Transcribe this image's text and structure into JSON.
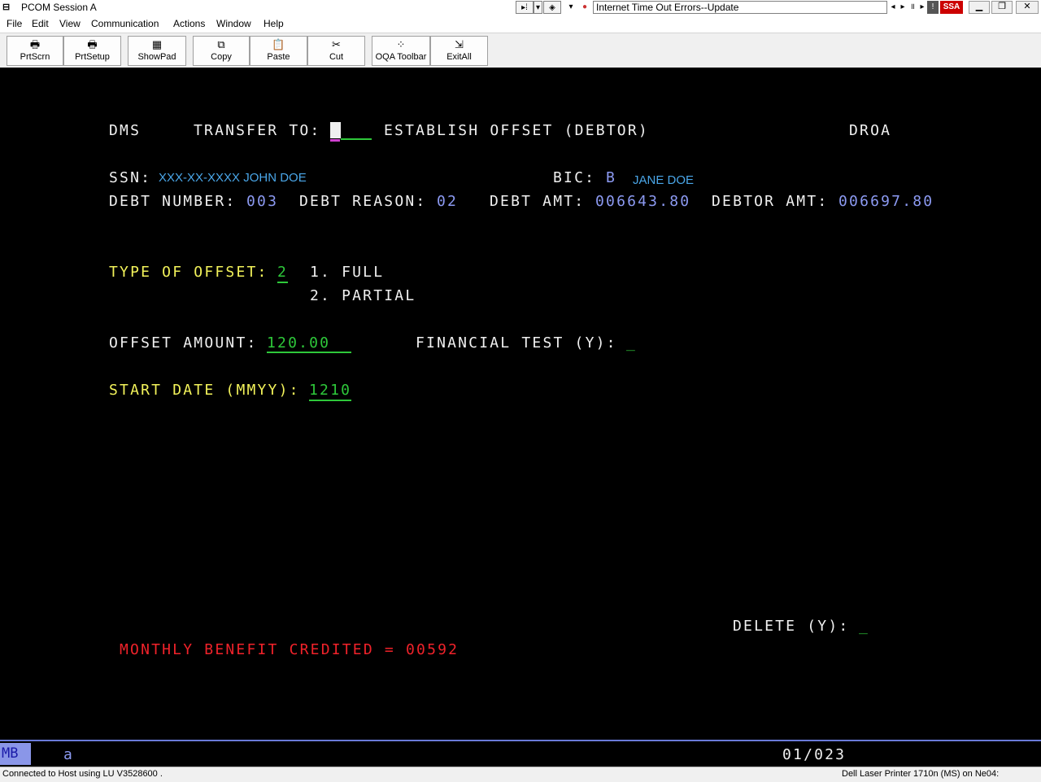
{
  "window": {
    "title": "PCOM Session A",
    "document_title": "Internet Time Out Errors--Update",
    "brand_badge": "SSA"
  },
  "menu": [
    "File",
    "Edit",
    "View",
    "Communication",
    "Actions",
    "Window",
    "Help"
  ],
  "toolbar": [
    "PrtScrn",
    "PrtSetup",
    "ShowPad",
    "Copy",
    "Paste",
    "Cut",
    "OQA Toolbar",
    "ExitAll"
  ],
  "screen": {
    "system": "DMS",
    "transfer_label": "TRANSFER TO:",
    "screen_title": "ESTABLISH OFFSET (DEBTOR)",
    "screen_id": "DROA",
    "ssn_label": "SSN:",
    "ssn_value": "XXX-XX-XXXX JOHN DOE",
    "bic_label": "BIC:",
    "bic_value": "B",
    "bic_name": "JANE DOE",
    "debt_number_label": "DEBT NUMBER:",
    "debt_number": "003",
    "debt_reason_label": "DEBT REASON:",
    "debt_reason": "02",
    "debt_amt_label": "DEBT AMT:",
    "debt_amt": "006643.80",
    "debtor_amt_label": "DEBTOR AMT:",
    "debtor_amt": "006697.80",
    "offset_type_label": "TYPE OF OFFSET:",
    "offset_type_value": "2",
    "option_1": "1. FULL",
    "option_2": "2. PARTIAL",
    "offset_amount_label": "OFFSET AMOUNT:",
    "offset_amount": "120.00",
    "financial_test_label": "FINANCIAL TEST (Y):",
    "financial_test_value": "_",
    "start_date_label": "START DATE (MMYY):",
    "start_date": "1210",
    "delete_label": "DELETE (Y):",
    "delete_value": "_",
    "message": "MONTHLY BENEFIT CREDITED = 00592"
  },
  "oia": {
    "mode": "MB",
    "indicator": "a",
    "cursor_position": "01/023"
  },
  "status": {
    "connection": "Connected to Host using LU V3528600 .",
    "printer": "Dell Laser Printer 1710n (MS) on Ne04:"
  }
}
